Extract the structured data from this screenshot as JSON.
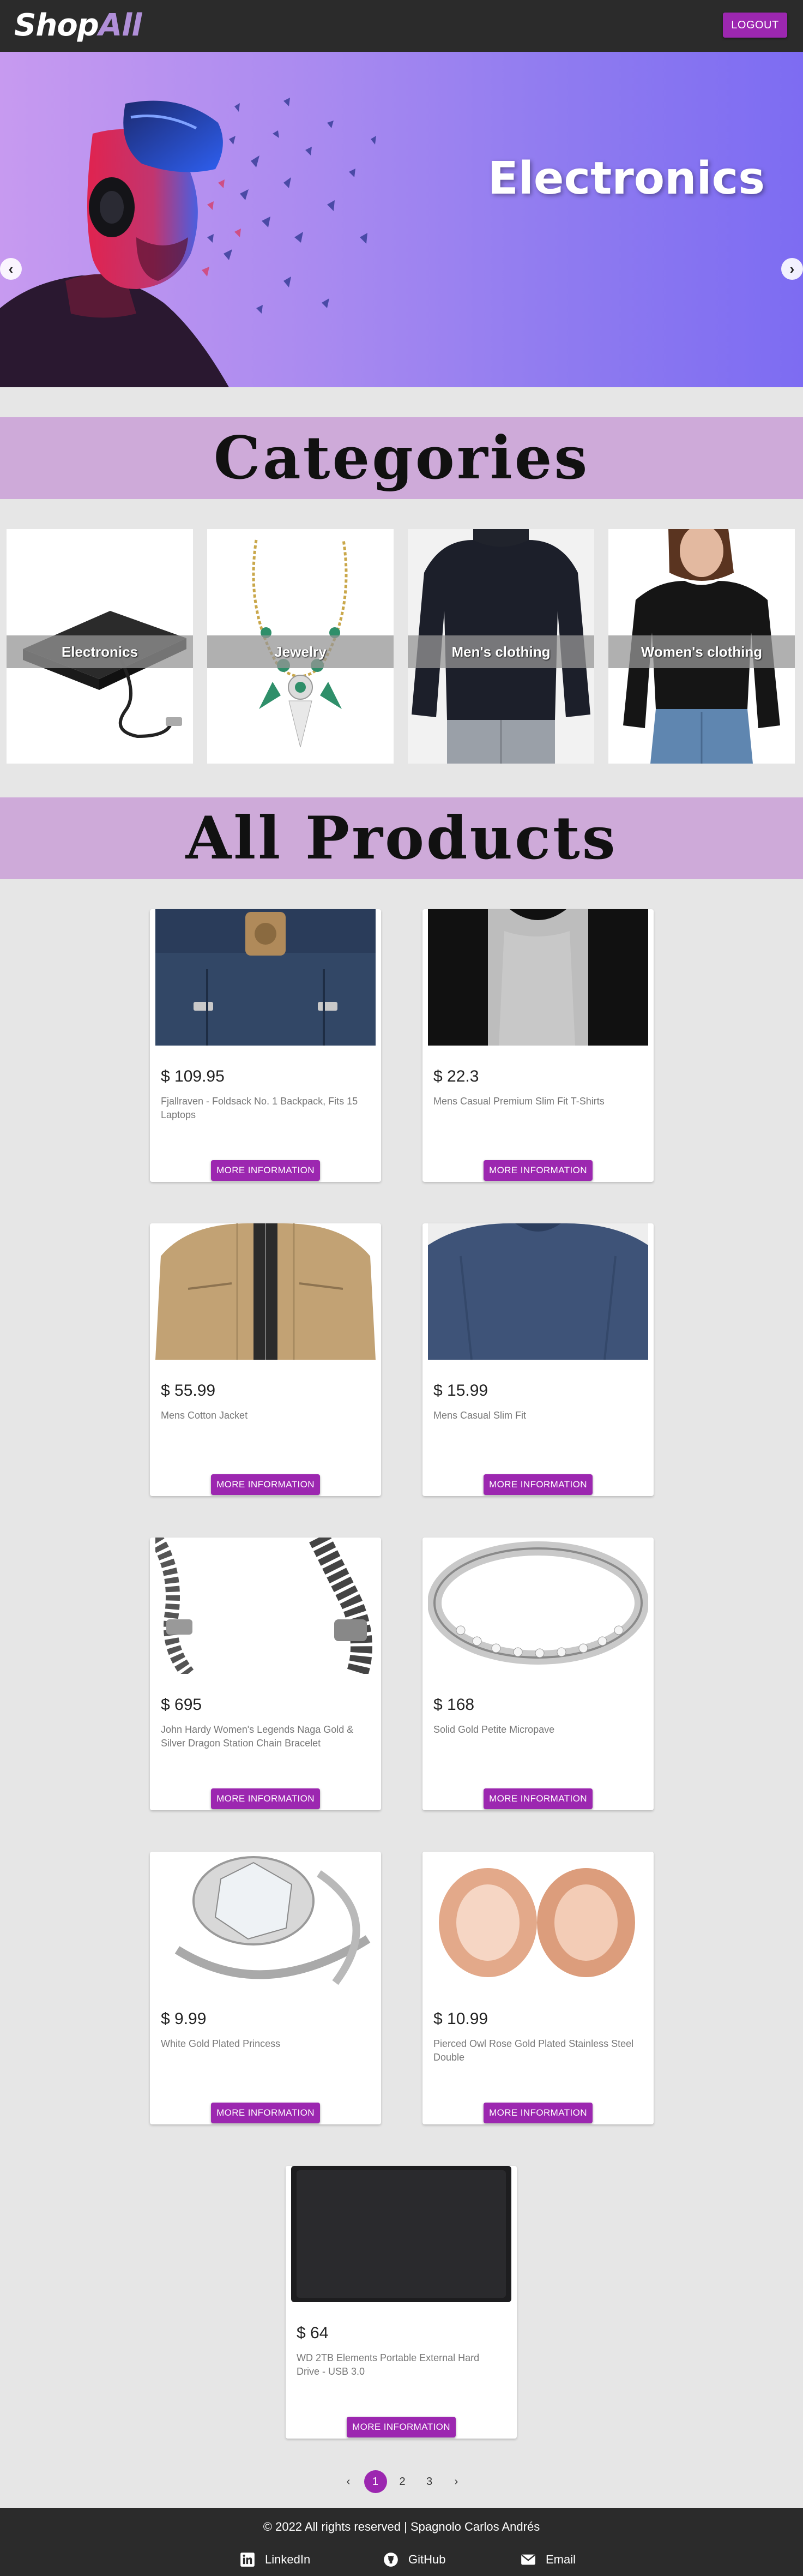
{
  "header": {
    "logo_part1": "Shop",
    "logo_part2": "All",
    "logout_label": "LOGOUT"
  },
  "carousel": {
    "slide_title": "Electronics",
    "prev_icon": "chevron-left-icon",
    "next_icon": "chevron-right-icon"
  },
  "categories_heading": "Categories",
  "categories": [
    {
      "label": "Electronics"
    },
    {
      "label": "Jewelry"
    },
    {
      "label": "Men's clothing"
    },
    {
      "label": "Women's clothing"
    }
  ],
  "products_heading": "All Products",
  "products": [
    {
      "price": "$ 109.95",
      "title": "Fjallraven - Foldsack No. 1 Backpack, Fits 15 Laptops",
      "button": "MORE INFORMATION"
    },
    {
      "price": "$ 22.3",
      "title": "Mens Casual Premium Slim Fit T-Shirts",
      "button": "MORE INFORMATION"
    },
    {
      "price": "$ 55.99",
      "title": "Mens Cotton Jacket",
      "button": "MORE INFORMATION"
    },
    {
      "price": "$ 15.99",
      "title": "Mens Casual Slim Fit",
      "button": "MORE INFORMATION"
    },
    {
      "price": "$ 695",
      "title": "John Hardy Women's Legends Naga Gold & Silver Dragon Station Chain Bracelet",
      "button": "MORE INFORMATION"
    },
    {
      "price": "$ 168",
      "title": "Solid Gold Petite Micropave",
      "button": "MORE INFORMATION"
    },
    {
      "price": "$ 9.99",
      "title": "White Gold Plated Princess",
      "button": "MORE INFORMATION"
    },
    {
      "price": "$ 10.99",
      "title": "Pierced Owl Rose Gold Plated Stainless Steel Double",
      "button": "MORE INFORMATION"
    },
    {
      "price": "$ 64",
      "title": "WD 2TB Elements Portable External Hard Drive - USB 3.0",
      "button": "MORE INFORMATION"
    }
  ],
  "pagination": {
    "prev": "‹",
    "pages": [
      "1",
      "2",
      "3"
    ],
    "active_page": "1",
    "next": "›"
  },
  "footer": {
    "copyright": "© 2022 All rights reserved | Spagnolo Carlos Andrés",
    "links": [
      {
        "label": "LinkedIn",
        "icon": "linkedin-icon"
      },
      {
        "label": "GitHub",
        "icon": "github-icon"
      },
      {
        "label": "Email",
        "icon": "email-icon"
      }
    ]
  },
  "colors": {
    "accent": "#9c27b0",
    "section_bar": "#ceaad9",
    "header_bg": "#2b2b2b",
    "page_bg": "#e6e6e6"
  }
}
